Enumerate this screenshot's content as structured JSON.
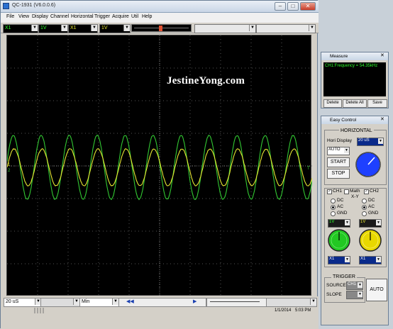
{
  "app": {
    "title": "QC-1931 (V6.0.0.6)",
    "minimize": "–",
    "maximize": "□",
    "close": "✕"
  },
  "menu": [
    "File",
    "View",
    "Display",
    "Channel",
    "Horizontal",
    "Trigger",
    "Acquire",
    "Util",
    "Help"
  ],
  "toolbar": {
    "ch1_probe": "X1",
    "ch1_volts": "1V",
    "ch2_probe": "X1",
    "ch2_volts": "1V"
  },
  "watermark": "JestineYong.com",
  "screen": {
    "ch1_marker": "1",
    "ch2_marker": "2",
    "trig_marker": "T",
    "ch1_color": "#e6e632",
    "ch2_color": "#32c832",
    "grid_color": "#555555"
  },
  "status": {
    "timebase": "20 uS",
    "mode": "Min",
    "nav_left": "◀◀",
    "nav_right": "▶",
    "date": "1/1/2014",
    "time": "5:03 PM"
  },
  "measure": {
    "title": "Measure",
    "reading": "CH1:Frequency = 54.35kHz",
    "delete": "Delete",
    "delete_all": "Delete All",
    "save": "Save"
  },
  "easy": {
    "title": "Easy Control",
    "horizontal": "HORIZONTAL",
    "hori_display": "Hori Display",
    "hori_value": "20 uS",
    "mode": "AUTO",
    "start": "START",
    "stop": "STOP",
    "ch1": "CH1",
    "math": "Math",
    "xy": "X-Y",
    "ch2": "CH2",
    "dc": "DC",
    "ac": "AC",
    "gnd": "GND",
    "ch1_volts": "1V",
    "ch2_volts": "1V",
    "ch1_probe": "X1",
    "ch2_probe": "X1",
    "trigger": "TRIGGER",
    "source": "SOURCE",
    "source_value": "CH1",
    "slope": "SLOPE",
    "auto": "AUTO",
    "knob_blue": "#1e40ff",
    "knob_green": "#22c822",
    "knob_yellow": "#e8d800"
  }
}
